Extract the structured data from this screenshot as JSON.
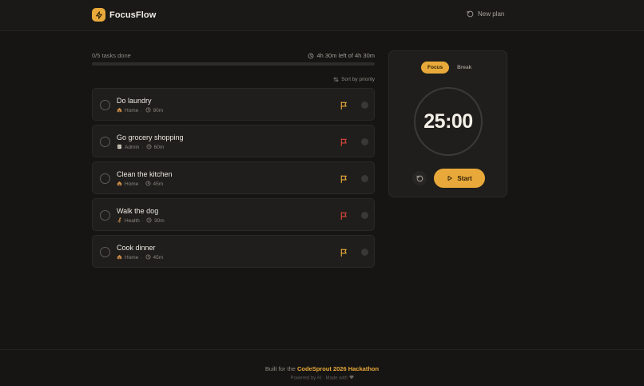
{
  "header": {
    "app_name": "FocusFlow",
    "new_plan_label": "New plan"
  },
  "progress": {
    "done_label": "0/5 tasks done",
    "time_left": "4h 30m left of 4h 30m",
    "fraction": 0
  },
  "sort_label": "Sort by priority",
  "tasks": [
    {
      "title": "Do laundry",
      "category_icon": "house-icon",
      "category": "Home",
      "duration": "90m",
      "flag_color": "#e9a93a"
    },
    {
      "title": "Go grocery shopping",
      "category_icon": "memo-icon",
      "category": "Admin",
      "duration": "60m",
      "flag_color": "#d9483b"
    },
    {
      "title": "Clean the kitchen",
      "category_icon": "house-icon",
      "category": "Home",
      "duration": "45m",
      "flag_color": "#e9a93a"
    },
    {
      "title": "Walk the dog",
      "category_icon": "runner-icon",
      "category": "Health",
      "duration": "30m",
      "flag_color": "#d9483b"
    },
    {
      "title": "Cook dinner",
      "category_icon": "house-icon",
      "category": "Home",
      "duration": "45m",
      "flag_color": "#e9a93a"
    }
  ],
  "timer": {
    "tabs": [
      {
        "label": "Focus",
        "active": true
      },
      {
        "label": "Break",
        "active": false
      }
    ],
    "time": "25:00",
    "start_label": "Start"
  },
  "footer": {
    "built_prefix": "Built for the",
    "hackathon": "CodeSprout 2026 Hackathon",
    "powered": "Powered by AI · Made with"
  },
  "colors": {
    "accent": "#e9a93a",
    "flag_high": "#d9483b",
    "background": "#161514"
  }
}
